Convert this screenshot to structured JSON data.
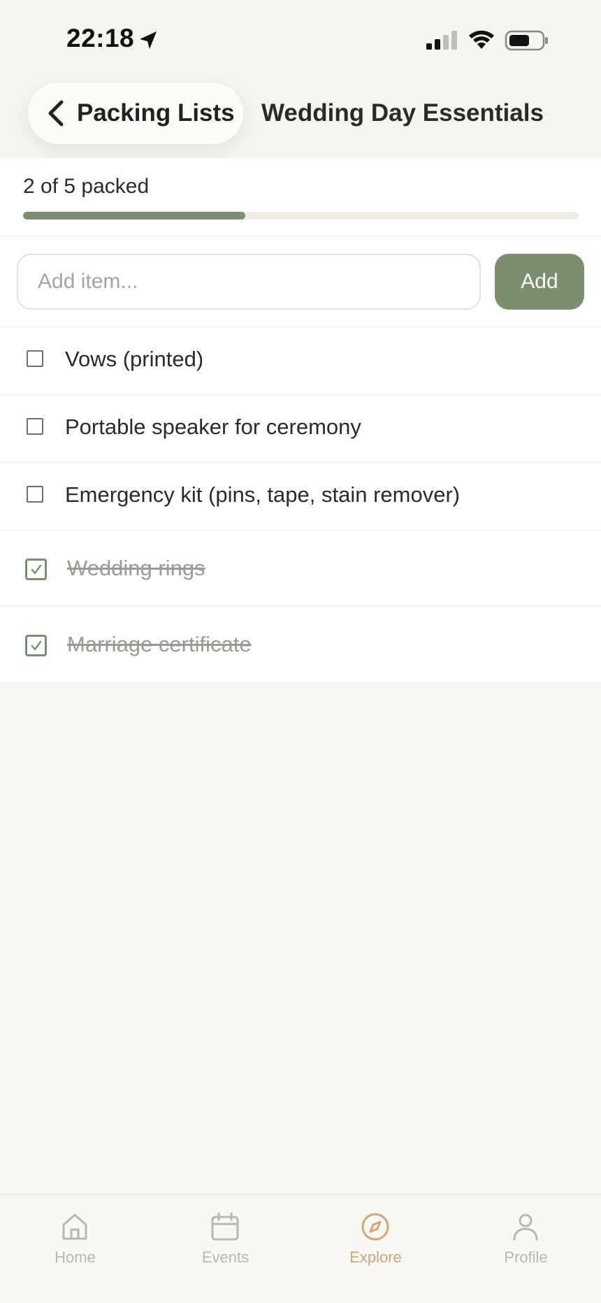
{
  "status_bar": {
    "time": "22:18"
  },
  "header": {
    "back_label": "Packing Lists",
    "title": "Wedding Day Essentials"
  },
  "progress": {
    "text": "2 of 5 packed",
    "packed": 2,
    "total": 5
  },
  "add_item": {
    "placeholder": "Add item...",
    "value": "",
    "button_label": "Add"
  },
  "items": [
    {
      "label": "Vows (printed)",
      "checked": false
    },
    {
      "label": "Portable speaker for ceremony",
      "checked": false
    },
    {
      "label": "Emergency kit (pins, tape, stain remover)",
      "checked": false
    },
    {
      "label": "Wedding rings",
      "checked": true
    },
    {
      "label": "Marriage certificate",
      "checked": true
    }
  ],
  "tabs": [
    {
      "label": "Home",
      "icon": "home-icon",
      "active": false
    },
    {
      "label": "Events",
      "icon": "calendar-icon",
      "active": false
    },
    {
      "label": "Explore",
      "icon": "compass-icon",
      "active": true
    },
    {
      "label": "Profile",
      "icon": "person-icon",
      "active": false
    }
  ],
  "colors": {
    "accent_green": "#7b8f6f",
    "active_tab": "#d4a574",
    "inactive_tab": "#b9b7b1",
    "background": "#f8f7f4"
  }
}
